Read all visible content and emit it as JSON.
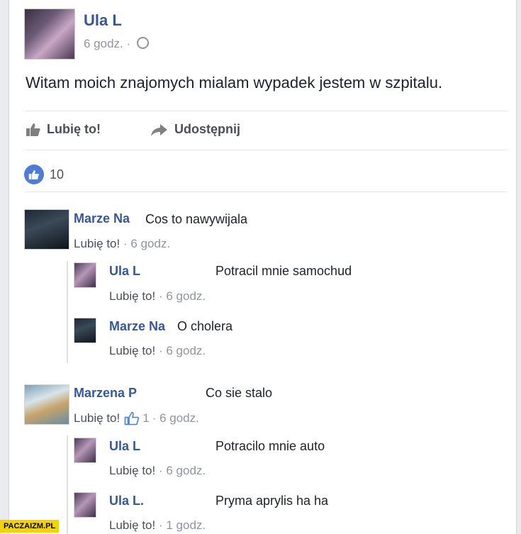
{
  "post": {
    "author": "Ula L",
    "time": "6 godz. ·",
    "text": "Witam moich znajomych mialam wypadek jestem w szpitalu.",
    "actions": {
      "like": "Lubię to!",
      "share": "Udostępnij"
    },
    "reaction_count": "10"
  },
  "comments": [
    {
      "author": "Marze Na",
      "text": "Cos to nawywijala",
      "like": "Lubię to!",
      "time": "· 6 godz."
    },
    {
      "author": "Ula L",
      "text": "Potracil mnie samochud",
      "like": "Lubię to!",
      "time": "· 6 godz."
    },
    {
      "author": "Marze Na",
      "text": "O cholera",
      "like": "Lubię to!",
      "time": "· 6 godz."
    },
    {
      "author": "Marzena P",
      "text": "Co sie stalo",
      "like": "Lubię to!",
      "likes": "1",
      "time": "· 6 godz."
    },
    {
      "author": "Ula L",
      "text": "Potracilo mnie auto",
      "like": "Lubię to!",
      "time": "· 6 godz."
    },
    {
      "author": "Ula L.",
      "text": "Pryma aprylis ha ha",
      "like": "Lubię to!",
      "time": "· 1 godz."
    }
  ],
  "watermark": "PACZAIZM.PL",
  "colors": {
    "name_blue": "#365899",
    "like_blue": "#4e7cd7",
    "meta_gray": "#90949c"
  }
}
